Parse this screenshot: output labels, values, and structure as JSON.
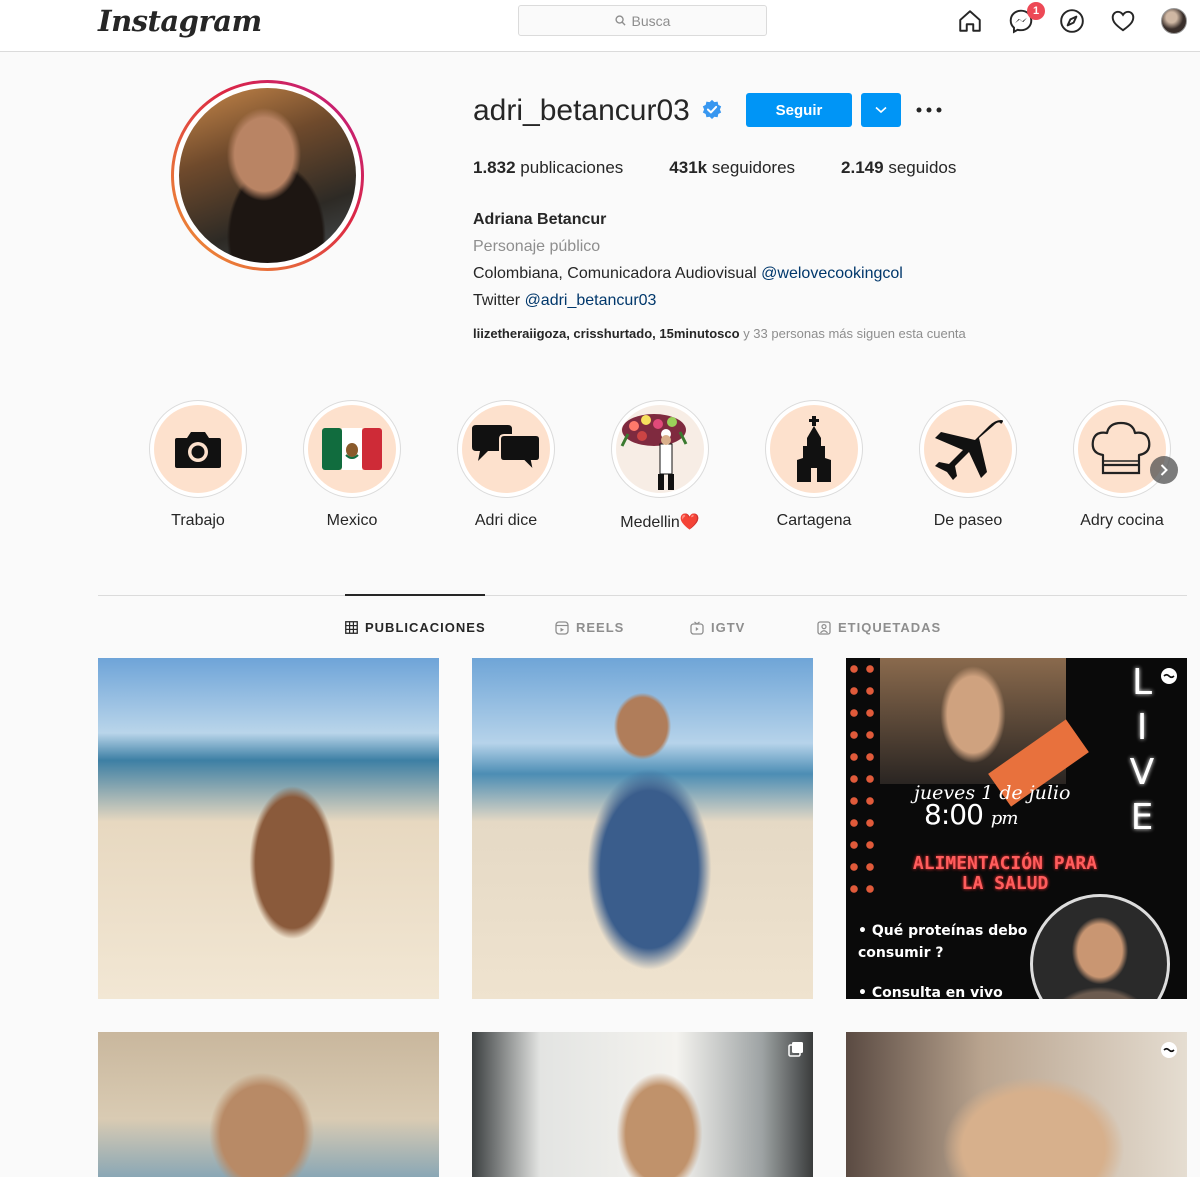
{
  "nav": {
    "logo": "Instagram",
    "search_placeholder": "Busca",
    "messages_badge": "1"
  },
  "profile": {
    "username": "adri_betancur03",
    "verified": true,
    "follow_label": "Seguir",
    "stats": {
      "posts_value": "1.832",
      "posts_label": "publicaciones",
      "followers_value": "431k",
      "followers_label": "seguidores",
      "following_value": "2.149",
      "following_label": "seguidos"
    },
    "bio": {
      "full_name": "Adriana Betancur",
      "category": "Personaje público",
      "line1_text": "Colombiana, Comunicadora Audiovisual ",
      "line1_link": "@welovecookingcol",
      "line2_text": "Twitter ",
      "line2_link": "@adri_betancur03"
    },
    "followed_by": {
      "names": "liizetheraiigoza, crisshurtado, 15minutosco",
      "rest": " y 33 personas más siguen esta cuenta"
    }
  },
  "highlights": [
    {
      "label": "Trabajo",
      "icon": "camera-icon"
    },
    {
      "label": "Mexico",
      "icon": "mexico-flag-icon"
    },
    {
      "label": "Adri dice",
      "icon": "speech-bubbles-icon"
    },
    {
      "label": "Medellin❤️",
      "icon": "flower-vendor-icon"
    },
    {
      "label": "Cartagena",
      "icon": "church-icon"
    },
    {
      "label": "De paseo",
      "icon": "airplane-icon"
    },
    {
      "label": "Adry cocina",
      "icon": "chef-hat-icon"
    }
  ],
  "tabs": [
    {
      "label": "PUBLICACIONES",
      "active": true
    },
    {
      "label": "REELS",
      "active": false
    },
    {
      "label": "IGTV",
      "active": false
    },
    {
      "label": "ETIQUETADAS",
      "active": false
    }
  ],
  "live_post": {
    "live_word": "LIVE",
    "date": "jueves 1 de julio",
    "time": "8:00",
    "time_suffix": "pm",
    "title_line1": "ALIMENTACIÓN PARA",
    "title_line2": "LA SALUD",
    "bullet1": "Qué proteínas debo consumir ?",
    "bullet2": "Consulta en vivo"
  },
  "colors": {
    "accent_blue": "#0095f6",
    "link_blue": "#00376b",
    "badge_red": "#ed4956",
    "highlight_bg": "#fde1cd"
  }
}
